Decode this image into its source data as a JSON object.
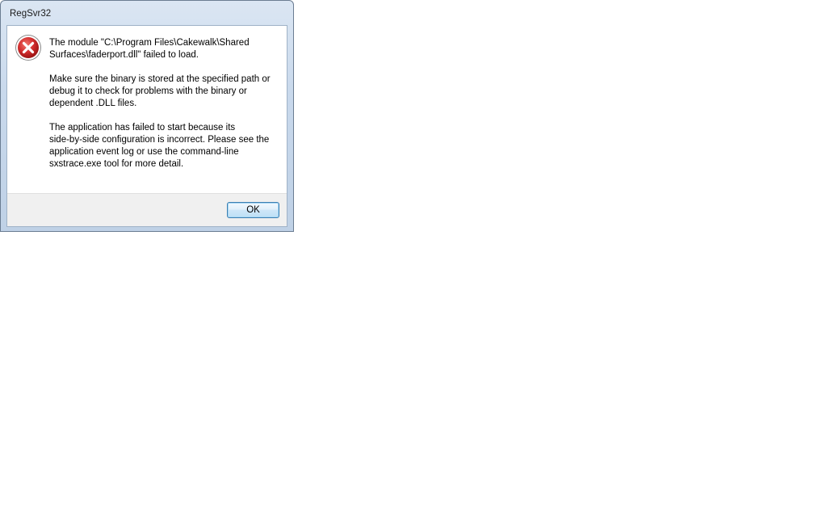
{
  "window": {
    "title": "RegSvr32"
  },
  "dialog": {
    "icon": "error-icon",
    "messages": [
      "The module \"C:\\Program Files\\Cakewalk\\Shared\nSurfaces\\faderport.dll\" failed to load.",
      "Make sure the binary is stored at the specified path or\ndebug it to check for problems with the binary or\ndependent .DLL files.",
      "The application has failed to start because its\nside-by-side configuration is incorrect. Please see the\napplication event log or use the command-line\nsxstrace.exe tool for more detail."
    ],
    "ok_label": "OK"
  },
  "colors": {
    "error_red": "#d32f2f",
    "button_border": "#3c7fb1"
  }
}
